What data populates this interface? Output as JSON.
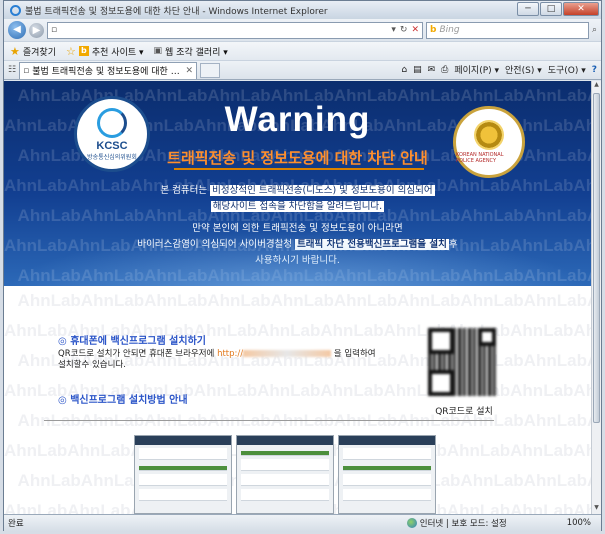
{
  "window": {
    "title": "불법 트래픽전송 및 정보도용에 대한 차단 안내 - Windows Internet Explorer",
    "minimize": "─",
    "maximize": "□",
    "close": "✕"
  },
  "address_bar": {
    "url": "",
    "search_placeholder": "Bing"
  },
  "favorites_bar": {
    "favorites_label": "즐겨찾기",
    "suggested_label": "추천 사이트 ▾",
    "gallery_label": "웹 조각 갤러리 ▾"
  },
  "tab": {
    "title": "불법 트래픽전송 및 정보도용에 대한 차단 안내..."
  },
  "command_bar": {
    "page": "페이지(P) ▾",
    "safety": "안전(S) ▾",
    "tools": "도구(O) ▾",
    "help": "?"
  },
  "watermark_word": "AhnLab",
  "banner": {
    "kcsc_text": "KCSC",
    "kcsc_sub": "방송통신심의위원회",
    "police_text": "KOREAN NATIONAL POLICE AGENCY",
    "warning": "Warning",
    "headline": "트래픽전송 및 정보도용에 대한 차단 안내",
    "p1_pre": "본 컴퓨터는 ",
    "p1_hl": "비정상적인 트래픽전송(디도스) 및 정보도용이 의심되어",
    "p1_line2": "해당사이트 접속을 차단함을 알려드립니다.",
    "p2_line1": "만약 본인에 의한 트래픽전송 및 정보도용이 아니라면",
    "p2_line2_pre": "바이러스감염이 의심되어 사이버경찰청 ",
    "p2_line2_hl": "트래픽 차단 전용백신프로그램을 설치",
    "p2_line2_post": "후",
    "p2_line3": "사용하시기 바랍니다."
  },
  "lower": {
    "section1_title": "◎ 휴대폰에 백신프로그램 설치하기",
    "desc_pre": "QR코드로 설치가 안되면 휴대폰 브라우저에 ",
    "desc_link": "http://",
    "desc_post": " 을 입력하여",
    "desc_line2": "설치할수 있습니다.",
    "qr_label": "QR코드로 설치",
    "section2_title": "◎ 백신프로그램 설치방법 안내"
  },
  "status_bar": {
    "left": "완료",
    "zone": "인터넷 | 보호 모드: 설정",
    "zoom": "100%"
  }
}
